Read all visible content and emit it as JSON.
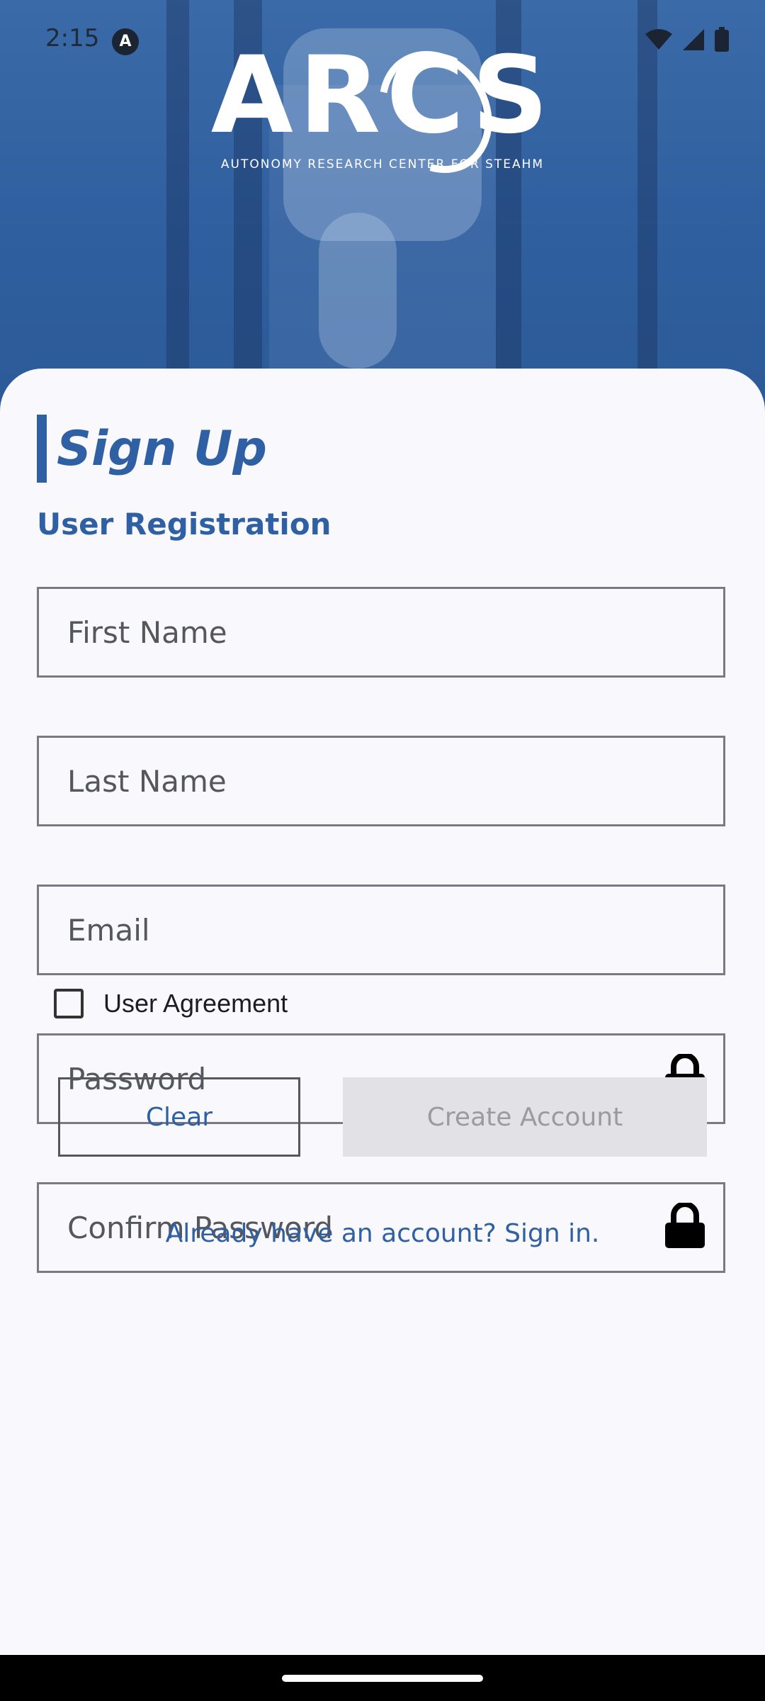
{
  "status_bar": {
    "time": "2:15",
    "app_icon": "A"
  },
  "logo": {
    "wordmark": "ARCS",
    "tagline": "AUTONOMY RESEARCH CENTER FOR STEAHM"
  },
  "form": {
    "title": "Sign Up",
    "subtitle": "User Registration",
    "fields": {
      "first_name": {
        "placeholder": "First Name",
        "value": ""
      },
      "last_name": {
        "placeholder": "Last Name",
        "value": ""
      },
      "email": {
        "placeholder": "Email",
        "value": ""
      },
      "password": {
        "placeholder": "Password",
        "value": ""
      },
      "confirm_password": {
        "placeholder": "Confirm Password",
        "value": ""
      }
    },
    "agreement": {
      "label": "User Agreement",
      "checked": false
    },
    "buttons": {
      "clear": "Clear",
      "create_account": "Create Account"
    },
    "signin_link": "Already have an account? Sign in."
  },
  "colors": {
    "accent": "#2f60a3",
    "disabled_button_bg": "#e2e2e6",
    "disabled_button_text": "#9a9aa0"
  },
  "icons": [
    "wifi-icon",
    "signal-icon",
    "battery-icon",
    "lock-icon"
  ]
}
